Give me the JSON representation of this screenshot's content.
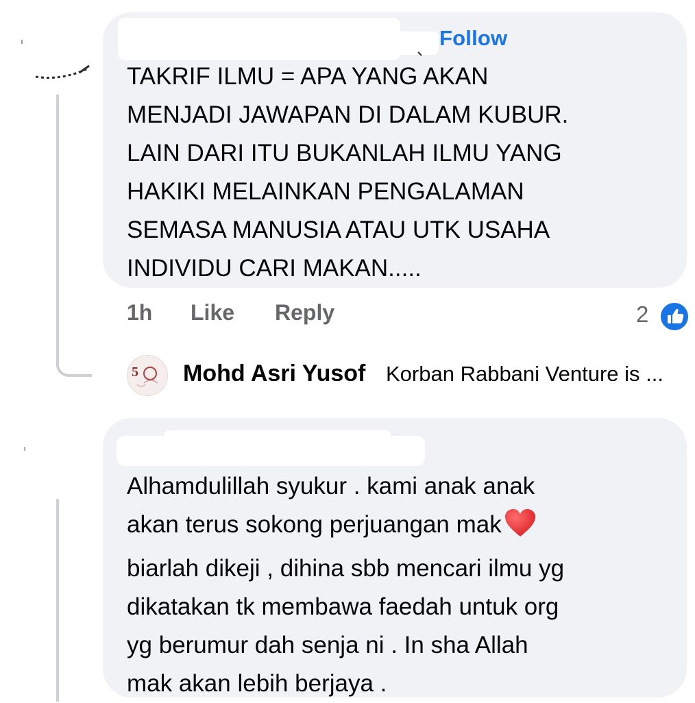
{
  "comments": [
    {
      "follow_label": "Follow",
      "text_lines": [
        "TAKRIF ILMU = APA YANG AKAN",
        "MENJADI JAWAPAN DI DALAM KUBUR.",
        "LAIN DARI ITU BUKANLAH ILMU YANG",
        "HAKIKI MELAINKAN PENGALAMAN",
        "SEMASA MANUSIA ATAU UTK USAHA",
        "INDIVIDU CARI MAKAN....."
      ],
      "timestamp": "1h",
      "like_label": "Like",
      "reply_label": "Reply",
      "reaction_count": "2",
      "reaction_icon": "thumbs-up-icon",
      "reply_preview": {
        "name": "Mohd Asri Yusof",
        "subtitle": "Korban Rabbani Venture is ..."
      }
    },
    {
      "text_lines": [
        "Alhamdulillah syukur . kami anak anak",
        "akan terus sokong perjuangan mak",
        "biarlah dikeji , dihina sbb mencari ilmu yg",
        "dikatakan tk membawa faedah untuk org",
        "yg berumur dah senja ni . In sha Allah",
        "mak akan lebih berjaya ."
      ],
      "heart_icon": "red-heart-icon"
    }
  ],
  "colors": {
    "bubble": "#f0f2f5",
    "link_blue": "#1b74e4",
    "meta_gray": "#65676b",
    "heart_red": "#e0262b"
  }
}
